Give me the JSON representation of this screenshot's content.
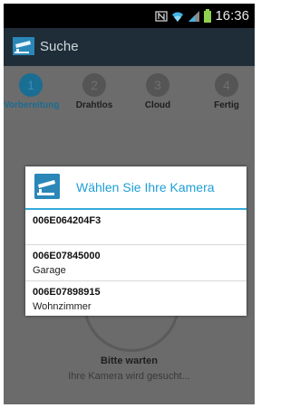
{
  "status_bar": {
    "time": "16:36",
    "icons": [
      "nfc-icon",
      "wifi-icon",
      "signal-icon",
      "battery-icon"
    ]
  },
  "app_bar": {
    "title": "Suche",
    "logo_icon": "camera-icon"
  },
  "steps": [
    {
      "number": "1",
      "label": "Vorbereitung",
      "active": true
    },
    {
      "number": "2",
      "label": "Drahtlos",
      "active": false
    },
    {
      "number": "3",
      "label": "Cloud",
      "active": false
    },
    {
      "number": "4",
      "label": "Fertig",
      "active": false
    }
  ],
  "dialog": {
    "title": "Wählen Sie Ihre Kamera",
    "icon": "camera-icon",
    "cameras": [
      {
        "id": "006E064204F3",
        "name": ""
      },
      {
        "id": "006E07845000",
        "name": "Garage"
      },
      {
        "id": "006E07898915",
        "name": "Wohnzimmer"
      }
    ]
  },
  "waiting": {
    "title": "Bitte warten",
    "subtitle": "Ihre Kamera wird gesucht..."
  },
  "colors": {
    "accent": "#1e9fd6",
    "active_step": "#1a6d93",
    "app_bar": "#1f2d38",
    "dim_overlay": "#6b6b6b"
  }
}
